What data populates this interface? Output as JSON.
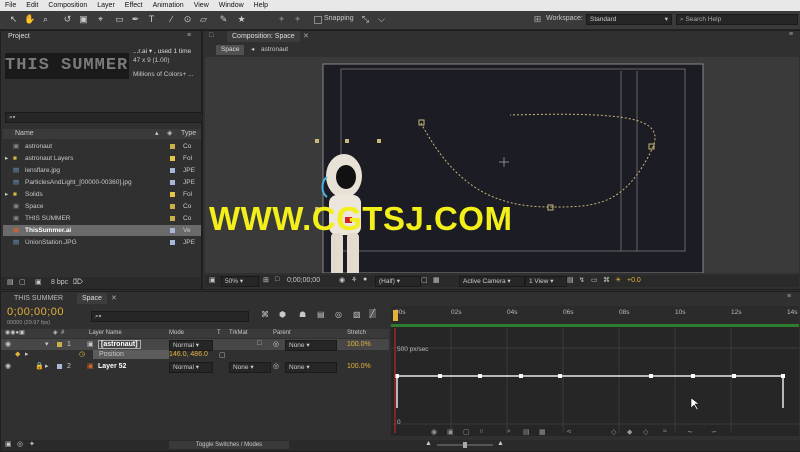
{
  "menu": [
    "File",
    "Edit",
    "Composition",
    "Layer",
    "Effect",
    "Animation",
    "View",
    "Window",
    "Help"
  ],
  "toolbar": {
    "snapping": "Snapping",
    "workspace_label": "Workspace:",
    "workspace_value": "Standard",
    "search_placeholder": "Search Help"
  },
  "project": {
    "tab": "Project",
    "thumb_text": "THIS SUMMER",
    "info_name": "...r.ai ▾ , used 1 time",
    "info_dims": "47 x 9 (1.00)",
    "info_colors": "Millions of Colors+ ...",
    "search_icon_text": "⌕▾",
    "col_name": "Name",
    "col_type": "Type",
    "items": [
      {
        "name": "astronaut",
        "type": "Co",
        "color": "#c9b04a",
        "icon": "comp"
      },
      {
        "name": "astronaut Layers",
        "type": "Fol",
        "color": "#e3c64a",
        "icon": "folder"
      },
      {
        "name": "lensflare.jpg",
        "type": "JPE",
        "color": "#a8b8d8",
        "icon": "image"
      },
      {
        "name": "ParticlesAndLight_[00000-00360].jpg",
        "type": "JPE",
        "color": "#a8b8d8",
        "icon": "image"
      },
      {
        "name": "Solids",
        "type": "Fol",
        "color": "#e3c64a",
        "icon": "folder"
      },
      {
        "name": "Space",
        "type": "Co",
        "color": "#c9b04a",
        "icon": "comp"
      },
      {
        "name": "THIS SUMMER",
        "type": "Co",
        "color": "#c9b04a",
        "icon": "comp"
      },
      {
        "name": "ThisSummer.ai",
        "type": "Ve",
        "color": "#a8b8d8",
        "icon": "ai"
      },
      {
        "name": "UnionStation.JPG",
        "type": "JPE",
        "color": "#a8b8d8",
        "icon": "image"
      }
    ],
    "bpc": "8 bpc"
  },
  "composition": {
    "tab": "Composition: Space",
    "breadcrumbs": [
      "Space",
      "astronaut"
    ],
    "zoom": "50%",
    "timecode": "0;00;00;00",
    "resolution": "(Half)",
    "camera": "Active Camera",
    "view": "1 View",
    "exposure": "+0.0"
  },
  "watermark": "WWW.CGTSJ.COM",
  "timeline": {
    "tabs": [
      "THIS SUMMER",
      "Space"
    ],
    "timecode": "0;00;00;00",
    "fps": "00000 (29.97 fps)",
    "search_icon_text": "⌕▾",
    "headers": {
      "layer_name": "Layer Name",
      "mode": "Mode",
      "t": "T",
      "trkmat": "TrkMat",
      "parent": "Parent",
      "stretch": "Stretch"
    },
    "layers": [
      {
        "num": "1",
        "name": "[astronaut]",
        "mode": "Normal",
        "trkmat": "",
        "parent": "None",
        "stretch": "100.0%"
      },
      {
        "num": "2",
        "name": "Layer 52",
        "mode": "Normal",
        "trkmat": "None",
        "parent": "None",
        "stretch": "100.0%"
      }
    ],
    "position_label": "Position",
    "position_value": "146.0, 486.0",
    "ruler": [
      "00s",
      "02s",
      "04s",
      "06s",
      "08s",
      "10s",
      "12s",
      "14s"
    ],
    "graph_label": "500 px/sec",
    "graph_zero": "0",
    "toggle": "Toggle Switches / Modes"
  }
}
